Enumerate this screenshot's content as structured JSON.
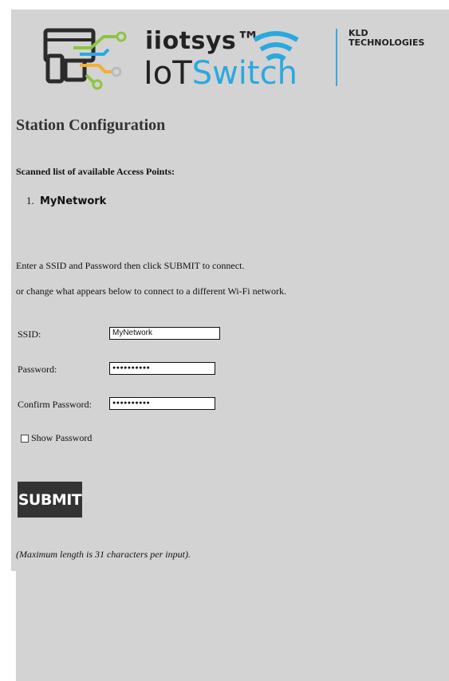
{
  "header": {
    "brand_top": "iiotsys™",
    "brand_main_part1": "IoT",
    "brand_main_part2": "Switch",
    "company_line1": "KLD",
    "company_line2": "TECHNOLOGIES"
  },
  "page": {
    "title": "Station Configuration",
    "scan_label": "Scanned list of available Access Points:",
    "access_points": [
      {
        "number": "1.",
        "name": "MyNetwork"
      }
    ],
    "instruction_1": "Enter a SSID and Password then click SUBMIT to connect.",
    "instruction_2": "or change what appears below to connect to a different Wi-Fi network."
  },
  "form": {
    "ssid_label": "SSID:",
    "ssid_value": "MyNetwork",
    "password_label": "Password:",
    "password_mask": "●●●●●●●●●●",
    "confirm_label": "Confirm Password:",
    "confirm_mask": "●●●●●●●●●●",
    "show_password_label": "Show Password",
    "show_password_checked": false,
    "submit_label": "SUBMIT",
    "note": "(Maximum length is 31 characters per input)."
  },
  "colors": {
    "background": "#d3d3d3",
    "accent_blue": "#29a9e0",
    "logo_green": "#8cc63f",
    "logo_dark": "#2b2b2b",
    "button": "#333333"
  }
}
